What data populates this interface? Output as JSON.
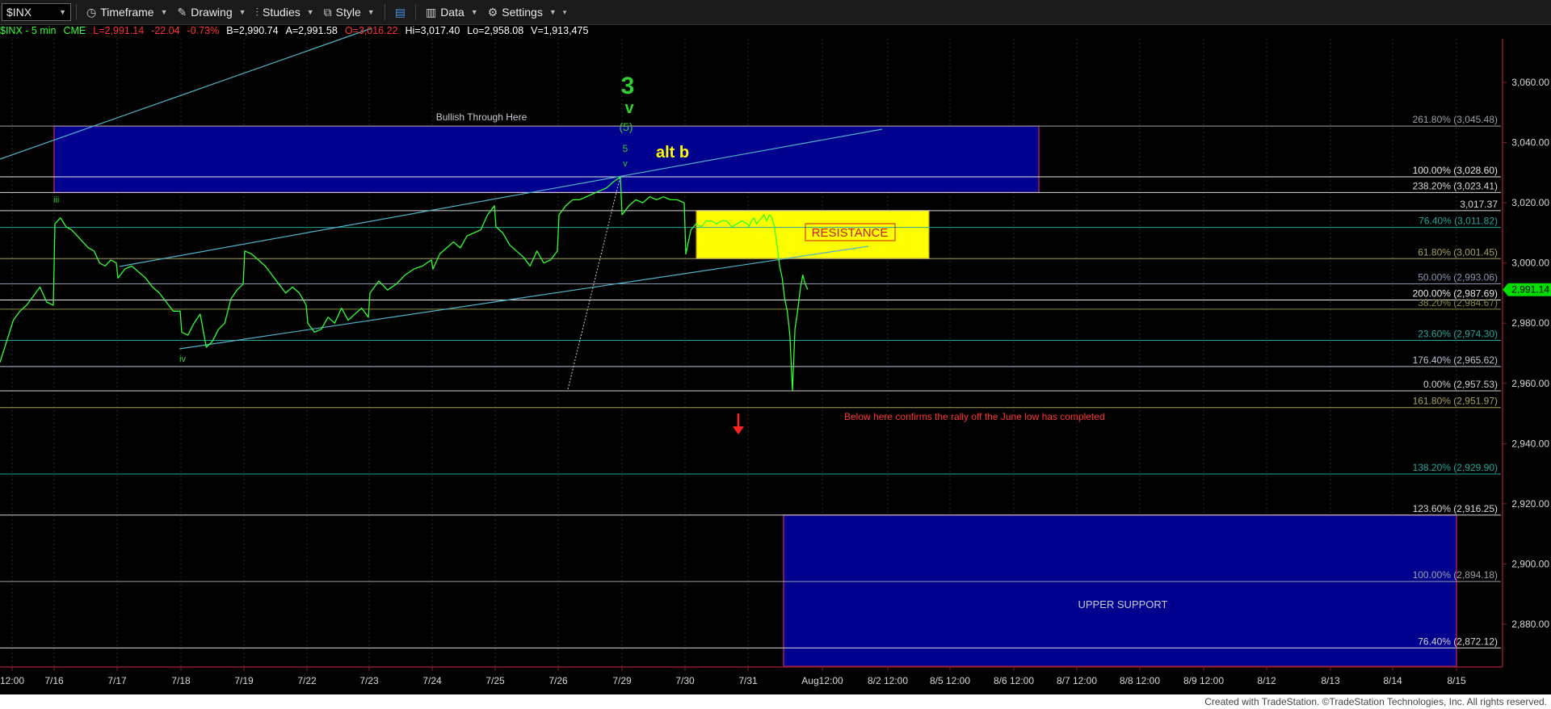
{
  "toolbar": {
    "symbol": "$INX",
    "timeframe_label": "Timeframe",
    "drawing_label": "Drawing",
    "studies_label": "Studies",
    "style_label": "Style",
    "data_label": "Data",
    "settings_label": "Settings"
  },
  "quote": {
    "symbol_interval": "$INX - 5 min",
    "exchange": "CME",
    "last": "L=2,991.14",
    "change": "-22.04",
    "change_pct": "-0.73%",
    "bid": "B=2,990.74",
    "ask": "A=2,991.58",
    "open": "O=3,016.22",
    "high": "Hi=3,017.40",
    "low": "Lo=2,958.08",
    "volume": "V=1,913,475"
  },
  "colors": {
    "background": "#000000",
    "price_line": "#33ff33",
    "channel": "#4fb4c8",
    "box_blue": "#00008f",
    "box_border": "#c0305a",
    "resistance_box": "#ffff00",
    "wave_labels": "#33cc33",
    "alt_label": "#ffff00",
    "warning_text": "#ff3333",
    "price_marker": "#00dd00"
  },
  "chart_data": {
    "type": "line",
    "series_type": "price",
    "interval": "5 min",
    "y_axis_ticks": [
      "3,060.00",
      "3,040.00",
      "3,020.00",
      "3,000.00",
      "2,980.00",
      "2,960.00",
      "2,940.00",
      "2,920.00",
      "2,900.00",
      "2,880.00"
    ],
    "y_tick_values": [
      3060,
      3040,
      3020,
      3000,
      2980,
      2960,
      2940,
      2920,
      2900,
      2880
    ],
    "ylim": [
      2866,
      3080
    ],
    "x_axis_ticks": [
      "12:00",
      "7/16",
      "7/17",
      "7/18",
      "7/19",
      "7/22",
      "7/23",
      "7/24",
      "7/25",
      "7/26",
      "7/29",
      "7/30",
      "7/31",
      "Aug12:00",
      "8/2 12:00",
      "8/5 12:00",
      "8/6 12:00",
      "8/7 12:00",
      "8/8 12:00",
      "8/9 12:00",
      "8/12",
      "8/13",
      "8/14",
      "8/15"
    ],
    "last_price_marker": "2,991.14",
    "last_price": 2991.14,
    "price_path": [
      {
        "session": "7/15",
        "values": [
          2967,
          2974,
          2981,
          2984,
          2986,
          2989,
          2992,
          2987,
          2986
        ]
      },
      {
        "session": "7/16",
        "values": [
          3013,
          3015,
          3012,
          3011,
          3009,
          3007,
          3005,
          3004,
          3000,
          2999,
          3001,
          3000
        ]
      },
      {
        "session": "7/17",
        "values": [
          2995,
          2998,
          2999,
          2997,
          2995,
          2992,
          2990,
          2987,
          2984,
          2984
        ]
      },
      {
        "session": "7/18",
        "values": [
          2977,
          2976,
          2980,
          2983,
          2972,
          2974,
          2978,
          2980,
          2988,
          2991,
          2993
        ]
      },
      {
        "session": "7/19",
        "values": [
          3004,
          3003,
          3001,
          2999,
          2996,
          2993,
          2990,
          2992,
          2990,
          2986
        ]
      },
      {
        "session": "7/22",
        "values": [
          2980,
          2977,
          2978,
          2982,
          2980,
          2985,
          2981,
          2983,
          2985,
          2982
        ]
      },
      {
        "session": "7/23",
        "values": [
          2990,
          2994,
          2991,
          2993,
          2996,
          2998,
          2999,
          3001
        ]
      },
      {
        "session": "7/24",
        "values": [
          2998,
          3003,
          3005,
          3007,
          3005,
          3009,
          3010,
          3011,
          3016,
          3019
        ]
      },
      {
        "session": "7/25",
        "values": [
          3012,
          3010,
          3006,
          3004,
          3002,
          2999,
          3004,
          3000,
          3001,
          3004
        ]
      },
      {
        "session": "7/26",
        "values": [
          3016,
          3019,
          3021,
          3021,
          3022,
          3023,
          3024,
          3025,
          3027,
          3028.6
        ]
      },
      {
        "session": "7/29",
        "values": [
          3016,
          3019,
          3021,
          3020,
          3022,
          3021,
          3022,
          3021,
          3021,
          3020
        ]
      },
      {
        "session": "7/30",
        "values": [
          3003,
          3011,
          3013,
          3012,
          3014,
          3014,
          3013,
          3014,
          3014,
          3012,
          3013,
          3014,
          3013
        ]
      },
      {
        "session": "7/31",
        "values": [
          3012,
          3014,
          3015,
          3013,
          3014,
          3015,
          3016,
          3014,
          3016,
          3015,
          3012,
          3006,
          2999,
          2995,
          2988,
          2984,
          2976,
          2957.5,
          2978,
          2984,
          2991,
          2996,
          2993,
          2991.14
        ]
      }
    ],
    "fib_levels": [
      {
        "label": "261.80% (3,045.48)",
        "value": 3045.48,
        "color": "#9aa0a8"
      },
      {
        "label": "100.00% (3,028.60)",
        "value": 3028.6,
        "color": "#e8e8e8"
      },
      {
        "label": "238.20% (3,023.41)",
        "value": 3023.41,
        "color": "#d8d8d8"
      },
      {
        "label": "3,017.37",
        "value": 3017.37,
        "color": "#d8d8d8"
      },
      {
        "label": "76.40% (3,011.82)",
        "value": 3011.82,
        "color": "#26a69a"
      },
      {
        "label": "61.80% (3,001.45)",
        "value": 3001.45,
        "color": "#a8a060"
      },
      {
        "label": "50.00% (2,993.06)",
        "value": 2993.06,
        "color": "#8a96ac"
      },
      {
        "label": "200.00% (2,987.69)",
        "value": 2987.69,
        "color": "#e8e8e8"
      },
      {
        "label": "38.20% (2,984.67)",
        "value": 2984.67,
        "color": "#8a8a40"
      },
      {
        "label": "23.60% (2,974.30)",
        "value": 2974.3,
        "color": "#26a69a"
      },
      {
        "label": "176.40% (2,965.62)",
        "value": 2965.62,
        "color": "#b8c8d8"
      },
      {
        "label": "0.00% (2,957.53)",
        "value": 2957.53,
        "color": "#cfcfcf"
      },
      {
        "label": "161.80% (2,951.97)",
        "value": 2951.97,
        "color": "#a8a060"
      },
      {
        "label": "138.20% (2,929.90)",
        "value": 2929.9,
        "color": "#26a69a"
      },
      {
        "label": "123.60% (2,916.25)",
        "value": 2916.25,
        "color": "#d8d8d8"
      },
      {
        "label": "100.00% (2,894.18)",
        "value": 2894.18,
        "color": "#9aa0a8"
      },
      {
        "label": "76.40% (2,872.12)",
        "value": 2872.12,
        "color": "#d8d8d8"
      }
    ],
    "zones": [
      {
        "label": "Bullish Through Here",
        "top": 3045.48,
        "bottom": 3023.41,
        "start_date": "7/16",
        "end_date": "8/5 12:00",
        "color": "#00008f"
      },
      {
        "label": "RESISTANCE",
        "top": 3017.37,
        "bottom": 3001.45,
        "start_date": "7/30",
        "end_date": "8/2 12:00",
        "color": "#ffff00"
      },
      {
        "label": "UPPER SUPPORT",
        "top": 2916.25,
        "bottom": 2866,
        "start_date": "7/31",
        "end_date": "8/15",
        "color": "#00008f"
      }
    ],
    "wave_labels": {
      "iii": "iii",
      "iv": "iv",
      "big_3": "3",
      "big_v": "v",
      "paren_5": "(5)",
      "small_5": "5",
      "small_v": "v",
      "alt_b": "alt b"
    },
    "annotations": {
      "confirm_text": "Below here confirms the rally off the June low has completed"
    }
  },
  "footer": {
    "credit": "Created with TradeStation. ©TradeStation Technologies, Inc. All rights reserved."
  }
}
